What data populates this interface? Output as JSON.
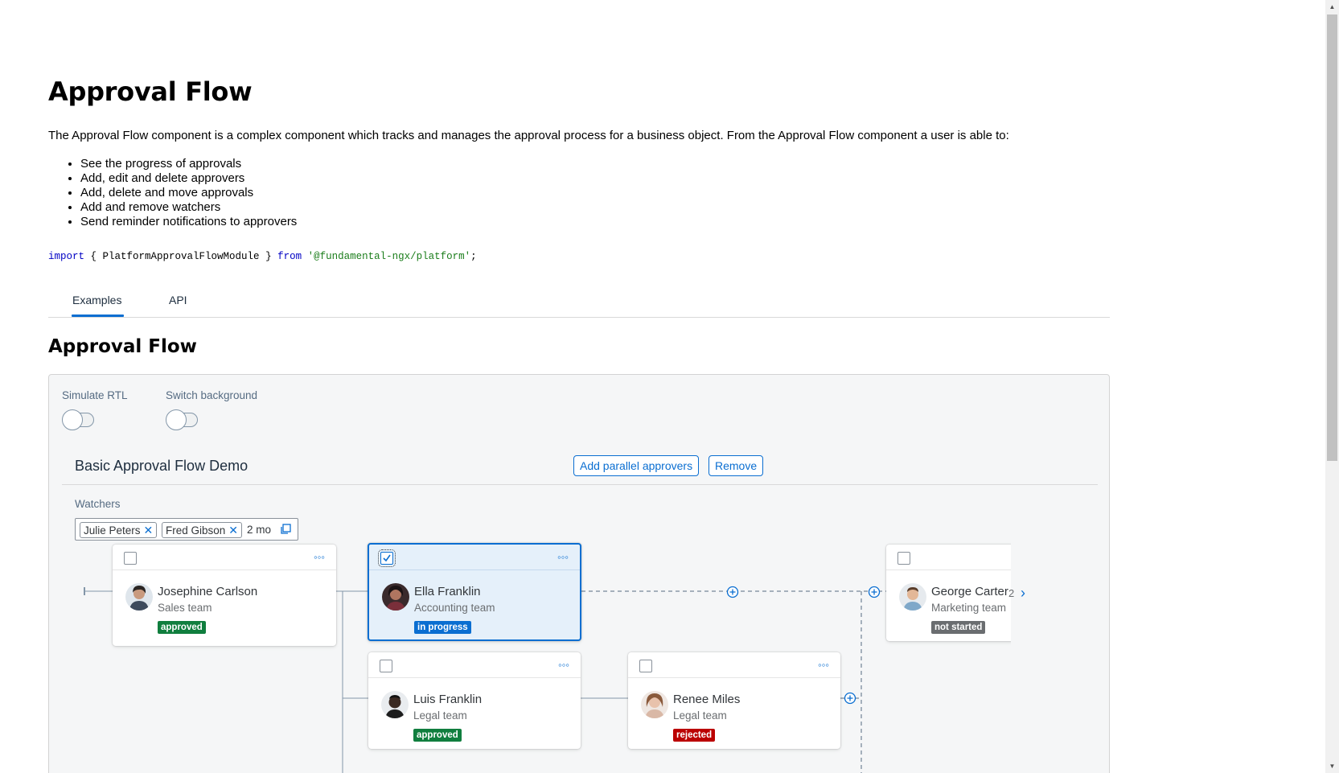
{
  "page": {
    "title": "Approval Flow",
    "intro": "The Approval Flow component is a complex component which tracks and manages the approval process for a business object. From the Approval Flow component a user is able to:",
    "features": [
      "See the progress of approvals",
      "Add, edit and delete approvers",
      "Add, delete and move approvals",
      "Add and remove watchers",
      "Send reminder notifications to approvers"
    ],
    "code": {
      "import_kw": "import",
      "brace_open": " { ",
      "module": "PlatformApprovalFlowModule",
      "brace_close": " } ",
      "from_kw": "from",
      "space": " ",
      "path": "'@fundamental-ngx/platform'",
      "semicolon": ";"
    }
  },
  "tabs": [
    {
      "label": "Examples",
      "active": true
    },
    {
      "label": "API",
      "active": false
    }
  ],
  "section": {
    "title": "Approval Flow"
  },
  "demo": {
    "switches": [
      {
        "label": "Simulate RTL",
        "on": false
      },
      {
        "label": "Switch background",
        "on": false
      }
    ],
    "flow_title": "Basic Approval Flow Demo",
    "buttons": {
      "add": "Add parallel approvers",
      "remove": "Remove"
    },
    "watchers": {
      "label": "Watchers",
      "tokens": [
        "Julie Peters",
        "Fred Gibson"
      ],
      "more": "2 mo"
    },
    "nodes": [
      {
        "name": "Josephine Carlson",
        "team": "Sales team",
        "status": "approved",
        "checked": false
      },
      {
        "name": "Ella Franklin",
        "team": "Accounting team",
        "status": "in progress",
        "checked": true
      },
      {
        "name": "Luis Franklin",
        "team": "Legal team",
        "status": "approved",
        "checked": false
      },
      {
        "name": "Renee Miles",
        "team": "Legal team",
        "status": "rejected",
        "checked": false
      },
      {
        "name": "George Carter",
        "team": "Marketing team",
        "status": "not started",
        "checked": false
      }
    ],
    "overflow_count": "2",
    "colors": {
      "accent": "#0a6ed1",
      "approved": "#107e3e",
      "in_progress": "#0a6ed1",
      "rejected": "#bb0000",
      "not_started": "#6a6d70"
    }
  }
}
